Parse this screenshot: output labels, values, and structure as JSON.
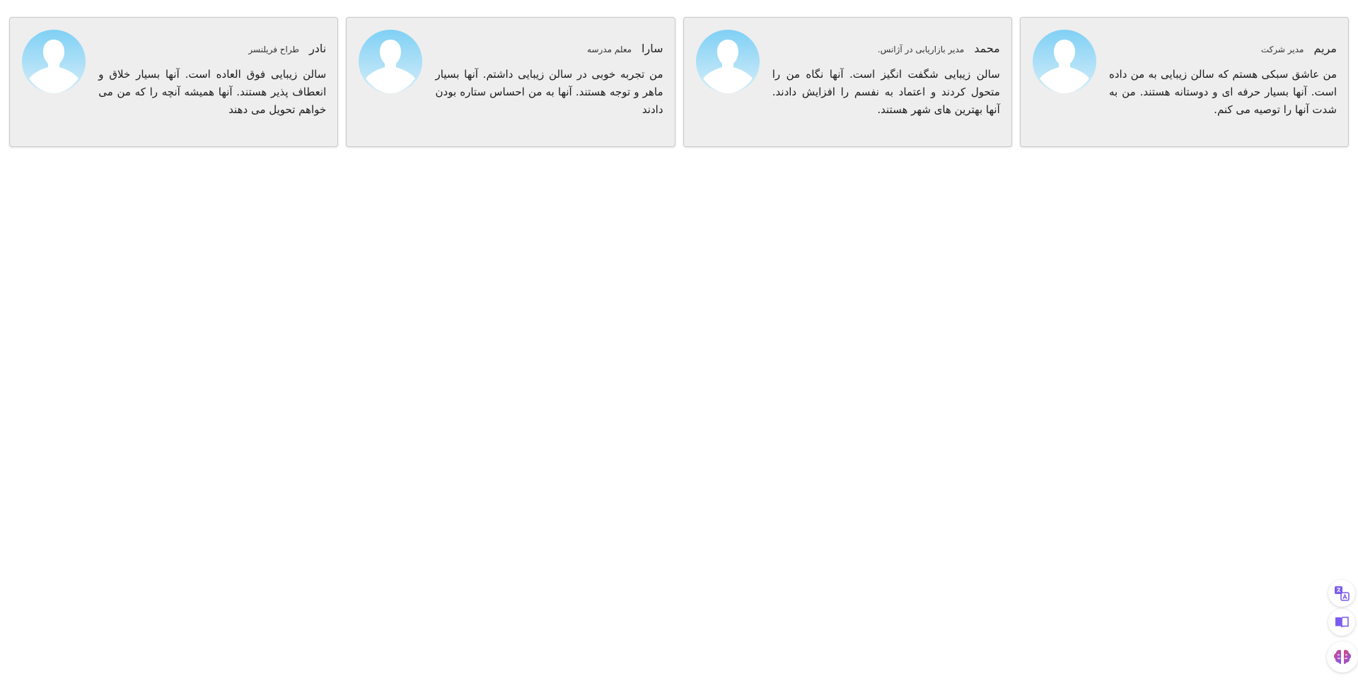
{
  "testimonials": [
    {
      "name": "مریم",
      "role": "مدیر شرکت",
      "quote": "من عاشق سبکی هستم که سالن زیبایی به من داده است. آنها بسیار حرفه ای و دوستانه هستند. من به شدت آنها را توصیه می کنم."
    },
    {
      "name": "محمد",
      "role": "مدیر بازاریابی در آژانس.",
      "quote": "سالن زیبایی شگفت انگیز است. آنها نگاه من را متحول کردند و اعتماد به نفسم را افزایش دادند. آنها بهترین های شهر هستند."
    },
    {
      "name": "سارا",
      "role": "معلم مدرسه",
      "quote": "من تجربه خوبی در سالن زیبایی داشتم. آنها بسیار ماهر و توجه هستند. آنها به من احساس ستاره بودن دادند"
    },
    {
      "name": "نادر",
      "role": "طراح فریلنسر",
      "quote": "سالن زیبایی فوق العاده است. آنها بسیار خلاق و انعطاف پذیر هستند. آنها همیشه آنچه را که من می خواهم تحویل می دهند"
    }
  ],
  "avatar_icon": "user-silhouette-icon",
  "floating_tools": [
    {
      "icon": "translate-icon"
    },
    {
      "icon": "reader-book-icon"
    },
    {
      "icon": "ai-brain-icon"
    }
  ],
  "colors": {
    "card_bg": "#eeeeee",
    "avatar_top": "#7fd0f5",
    "avatar_bottom": "#d6eef9",
    "tool_accent": "#7b5cf0"
  }
}
